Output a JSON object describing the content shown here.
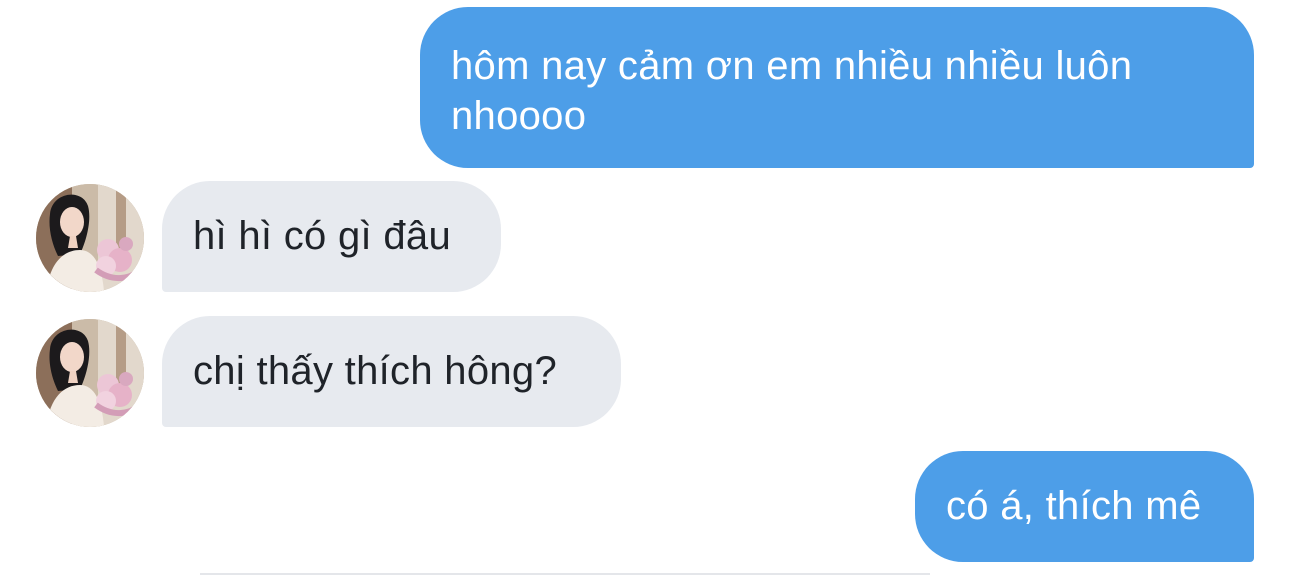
{
  "conversation": {
    "messages": [
      {
        "direction": "outgoing",
        "text": "hôm nay cảm ơn em nhiều nhiều luôn nhoooo"
      },
      {
        "direction": "incoming",
        "text": "hì hì có gì đâu",
        "avatar": "contact-avatar"
      },
      {
        "direction": "incoming",
        "text": "chị thấy thích hông?",
        "avatar": "contact-avatar"
      },
      {
        "direction": "outgoing",
        "text": "có á, thích mê"
      }
    ]
  },
  "colors": {
    "outgoing_bubble": "#4d9ee8",
    "incoming_bubble": "#e7eaef",
    "outgoing_text": "#ffffff",
    "incoming_text": "#1f2329"
  }
}
